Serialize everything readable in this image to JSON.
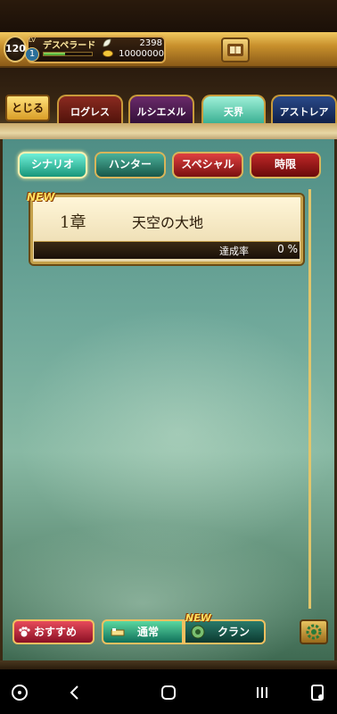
{
  "player": {
    "level": "120",
    "level_label": "LV",
    "rank": "1",
    "name": "デスペラード",
    "stamina": "2398",
    "gold": "10000000",
    "exp_fraction": 0.45
  },
  "nav": {
    "close_label": "とじる",
    "tabs": [
      "ログレス",
      "ルシエメル",
      "天界",
      "アストレア"
    ],
    "active_tab": "天界"
  },
  "filters": [
    "シナリオ",
    "ハンター",
    "スペシャル",
    "時限"
  ],
  "chapter": {
    "badge": "NEW",
    "number": "1章",
    "title": "天空の大地",
    "progress_label": "達成率",
    "progress_value": "0 %"
  },
  "bottom": {
    "recommend_label": "おすすめ",
    "normal_label": "通常",
    "clan_label": "クラン",
    "clan_badge": "NEW"
  },
  "colors": {
    "gold_border": "#d8b55a",
    "scenario_active": "#18967a",
    "special": "#7a1010",
    "map_teal": "#6fa89a"
  }
}
